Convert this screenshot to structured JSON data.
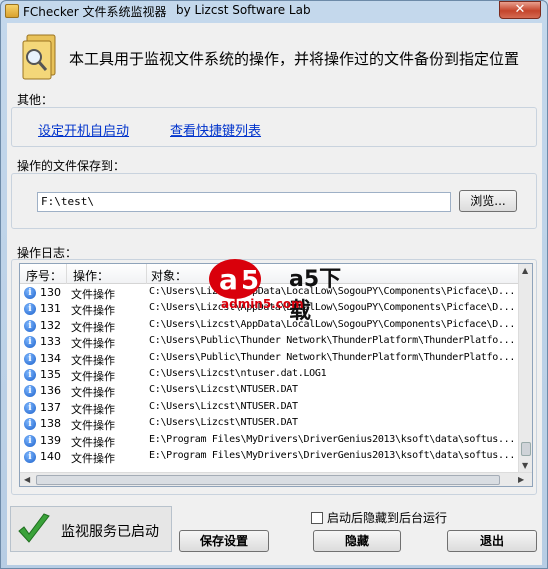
{
  "window": {
    "title": "FChecker 文件系统监视器",
    "vendor": "by Lizcst Software Lab",
    "close_label": "✕"
  },
  "hero": {
    "description": "本工具用于监视文件系统的操作，并将操作过的文件备份到指定位置"
  },
  "other": {
    "label": "其他：",
    "autostart_link": "设定开机自启动",
    "hotkeys_link": "查看快捷键列表"
  },
  "save_path": {
    "label": "操作的文件保存到：",
    "value": "F:\\test\\",
    "browse_label": "浏览..."
  },
  "log": {
    "label": "操作日志：",
    "columns": [
      "序号：",
      "操作：",
      "对象："
    ],
    "rows": [
      {
        "num": "130",
        "op": "文件操作",
        "obj": "C:\\Users\\Lizcst\\AppData\\LocalLow\\SogouPY\\Components\\Picface\\D..."
      },
      {
        "num": "131",
        "op": "文件操作",
        "obj": "C:\\Users\\Lizcst\\AppData\\LocalLow\\SogouPY\\Components\\Picface\\D..."
      },
      {
        "num": "132",
        "op": "文件操作",
        "obj": "C:\\Users\\Lizcst\\AppData\\LocalLow\\SogouPY\\Components\\Picface\\D..."
      },
      {
        "num": "133",
        "op": "文件操作",
        "obj": "C:\\Users\\Public\\Thunder Network\\ThunderPlatform\\ThunderPlatfo..."
      },
      {
        "num": "134",
        "op": "文件操作",
        "obj": "C:\\Users\\Public\\Thunder Network\\ThunderPlatform\\ThunderPlatfo..."
      },
      {
        "num": "135",
        "op": "文件操作",
        "obj": "C:\\Users\\Lizcst\\ntuser.dat.LOG1"
      },
      {
        "num": "136",
        "op": "文件操作",
        "obj": "C:\\Users\\Lizcst\\NTUSER.DAT"
      },
      {
        "num": "137",
        "op": "文件操作",
        "obj": "C:\\Users\\Lizcst\\NTUSER.DAT"
      },
      {
        "num": "138",
        "op": "文件操作",
        "obj": "C:\\Users\\Lizcst\\NTUSER.DAT"
      },
      {
        "num": "139",
        "op": "文件操作",
        "obj": "E:\\Program Files\\MyDrivers\\DriverGenius2013\\ksoft\\data\\softus..."
      },
      {
        "num": "140",
        "op": "文件操作",
        "obj": "E:\\Program Files\\MyDrivers\\DriverGenius2013\\ksoft\\data\\softus..."
      }
    ],
    "info_glyph": "i"
  },
  "status": {
    "text": "监视服务已启动"
  },
  "options": {
    "hide_on_start_label": "启动后隐藏到后台运行",
    "hide_on_start_checked": false
  },
  "buttons": {
    "save": "保存设置",
    "hide": "隐藏",
    "exit": "退出"
  },
  "watermark": {
    "brand": "a5下载",
    "site": "admin5.com"
  },
  "colors": {
    "link": "#0033cc",
    "title_bg": "#c4d8ec",
    "accent_red": "#d9000b",
    "check_green": "#3aa23a"
  }
}
